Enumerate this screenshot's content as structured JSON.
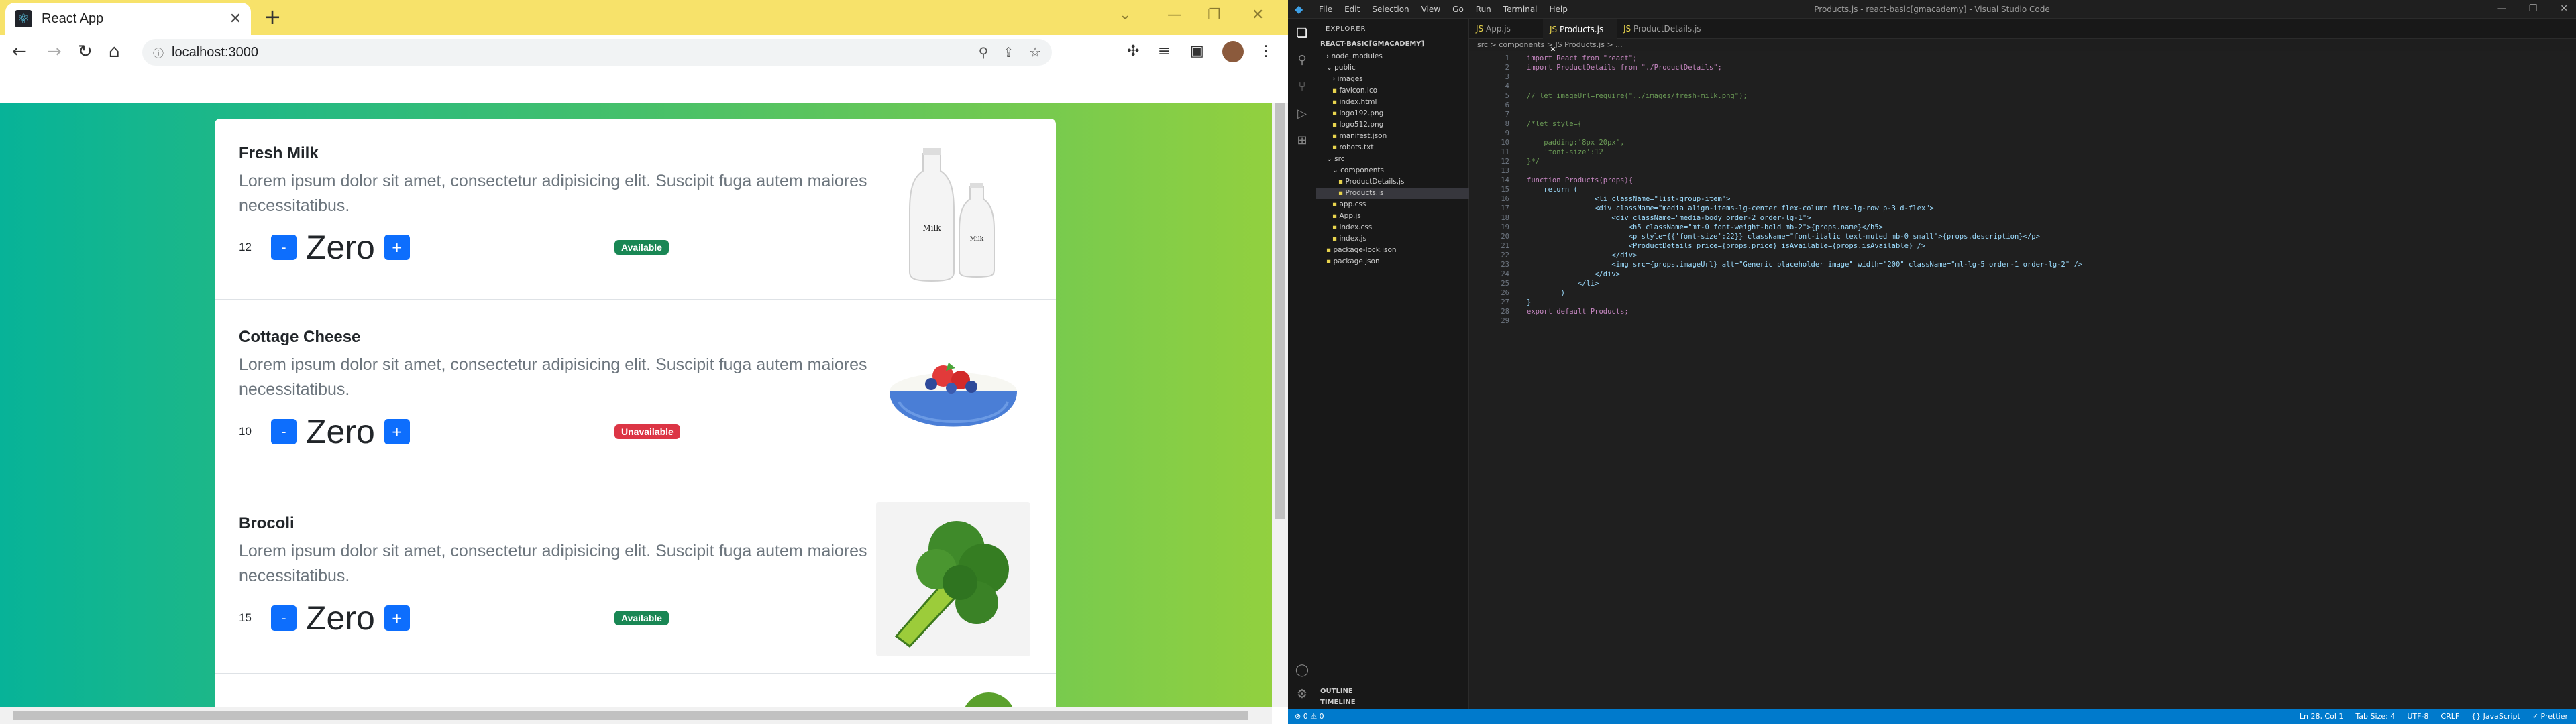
{
  "browser": {
    "tab_title": "React App",
    "tab_close": "✕",
    "new_tab": "+",
    "url": "localhost:3000"
  },
  "products": [
    {
      "name": "Fresh Milk",
      "description": "Lorem ipsum dolor sit amet, consectetur adipisicing elit. Suscipit fuga autem maiores necessitatibus.",
      "price": "12",
      "quantity": "Zero",
      "status": "Available",
      "available": true
    },
    {
      "name": "Cottage Cheese",
      "description": "Lorem ipsum dolor sit amet, consectetur adipisicing elit. Suscipit fuga autem maiores necessitatibus.",
      "price": "10",
      "quantity": "Zero",
      "status": "Unavailable",
      "available": false
    },
    {
      "name": "Brocoli",
      "description": "Lorem ipsum dolor sit amet, consectetur adipisicing elit. Suscipit fuga autem maiores necessitatibus.",
      "price": "15",
      "quantity": "Zero",
      "status": "Available",
      "available": true
    }
  ],
  "buttons": {
    "minus": "-",
    "plus": "+"
  },
  "vscode": {
    "menu": [
      "File",
      "Edit",
      "Selection",
      "View",
      "Go",
      "Run",
      "Terminal",
      "Help"
    ],
    "window_title": "Products.js - react-basic[gmacademy] - Visual Studio Code",
    "explorer_header": "EXPLORER",
    "project": "REACT-BASIC[GMACADEMY]",
    "tree": [
      {
        "label": "node_modules",
        "indent": 1,
        "kind": "folder"
      },
      {
        "label": "public",
        "indent": 1,
        "kind": "folder-open"
      },
      {
        "label": "images",
        "indent": 2,
        "kind": "folder"
      },
      {
        "label": "favicon.ico",
        "indent": 2,
        "kind": "file"
      },
      {
        "label": "index.html",
        "indent": 2,
        "kind": "file"
      },
      {
        "label": "logo192.png",
        "indent": 2,
        "kind": "file"
      },
      {
        "label": "logo512.png",
        "indent": 2,
        "kind": "file"
      },
      {
        "label": "manifest.json",
        "indent": 2,
        "kind": "file"
      },
      {
        "label": "robots.txt",
        "indent": 2,
        "kind": "file"
      },
      {
        "label": "src",
        "indent": 1,
        "kind": "folder-open"
      },
      {
        "label": "components",
        "indent": 2,
        "kind": "folder-open"
      },
      {
        "label": "ProductDetails.js",
        "indent": 3,
        "kind": "file"
      },
      {
        "label": "Products.js",
        "indent": 3,
        "kind": "file",
        "selected": true
      },
      {
        "label": "app.css",
        "indent": 2,
        "kind": "file"
      },
      {
        "label": "App.js",
        "indent": 2,
        "kind": "file"
      },
      {
        "label": "index.css",
        "indent": 2,
        "kind": "file"
      },
      {
        "label": "index.js",
        "indent": 2,
        "kind": "file"
      },
      {
        "label": "package-lock.json",
        "indent": 1,
        "kind": "file"
      },
      {
        "label": "package.json",
        "indent": 1,
        "kind": "file"
      }
    ],
    "outline": "OUTLINE",
    "timeline": "TIMELINE",
    "tabs": [
      "App.js",
      "Products.js",
      "ProductDetails.js"
    ],
    "breadcrumb": "src > components > JS Products.js > ...",
    "code": [
      "import React from \"react\";",
      "import ProductDetails from \"./ProductDetails\";",
      "",
      "",
      "// let imageUrl=require(\"../images/fresh-milk.png\");",
      "",
      "",
      "/*let style={",
      "",
      "    padding:'8px 20px',",
      "    'font-size':12",
      "}*/",
      "",
      "function Products(props){",
      "    return (",
      "                <li className=\"list-group-item\">",
      "                <div className=\"media align-items-lg-center flex-column flex-lg-row p-3 d-flex\">",
      "                    <div className=\"media-body order-2 order-lg-1\">",
      "                        <h5 className=\"mt-0 font-weight-bold mb-2\">{props.name}</h5>",
      "                        <p style={{'font-size':22}} className=\"font-italic text-muted mb-0 small\">{props.description}</p>",
      "                        <ProductDetails price={props.price} isAvailable={props.isAvailable} />",
      "                    </div>",
      "                    <img src={props.imageUrl} alt=\"Generic placeholder image\" width=\"200\" className=\"ml-lg-5 order-1 order-lg-2\" />",
      "                </div>",
      "            </li>",
      "        )",
      "}",
      "export default Products;",
      ""
    ],
    "status_left": "⊗ 0 ⚠ 0",
    "status_right": [
      "Ln 28, Col 1",
      "Tab Size: 4",
      "UTF-8",
      "CRLF",
      "{} JavaScript",
      "✓ Prettier"
    ]
  }
}
